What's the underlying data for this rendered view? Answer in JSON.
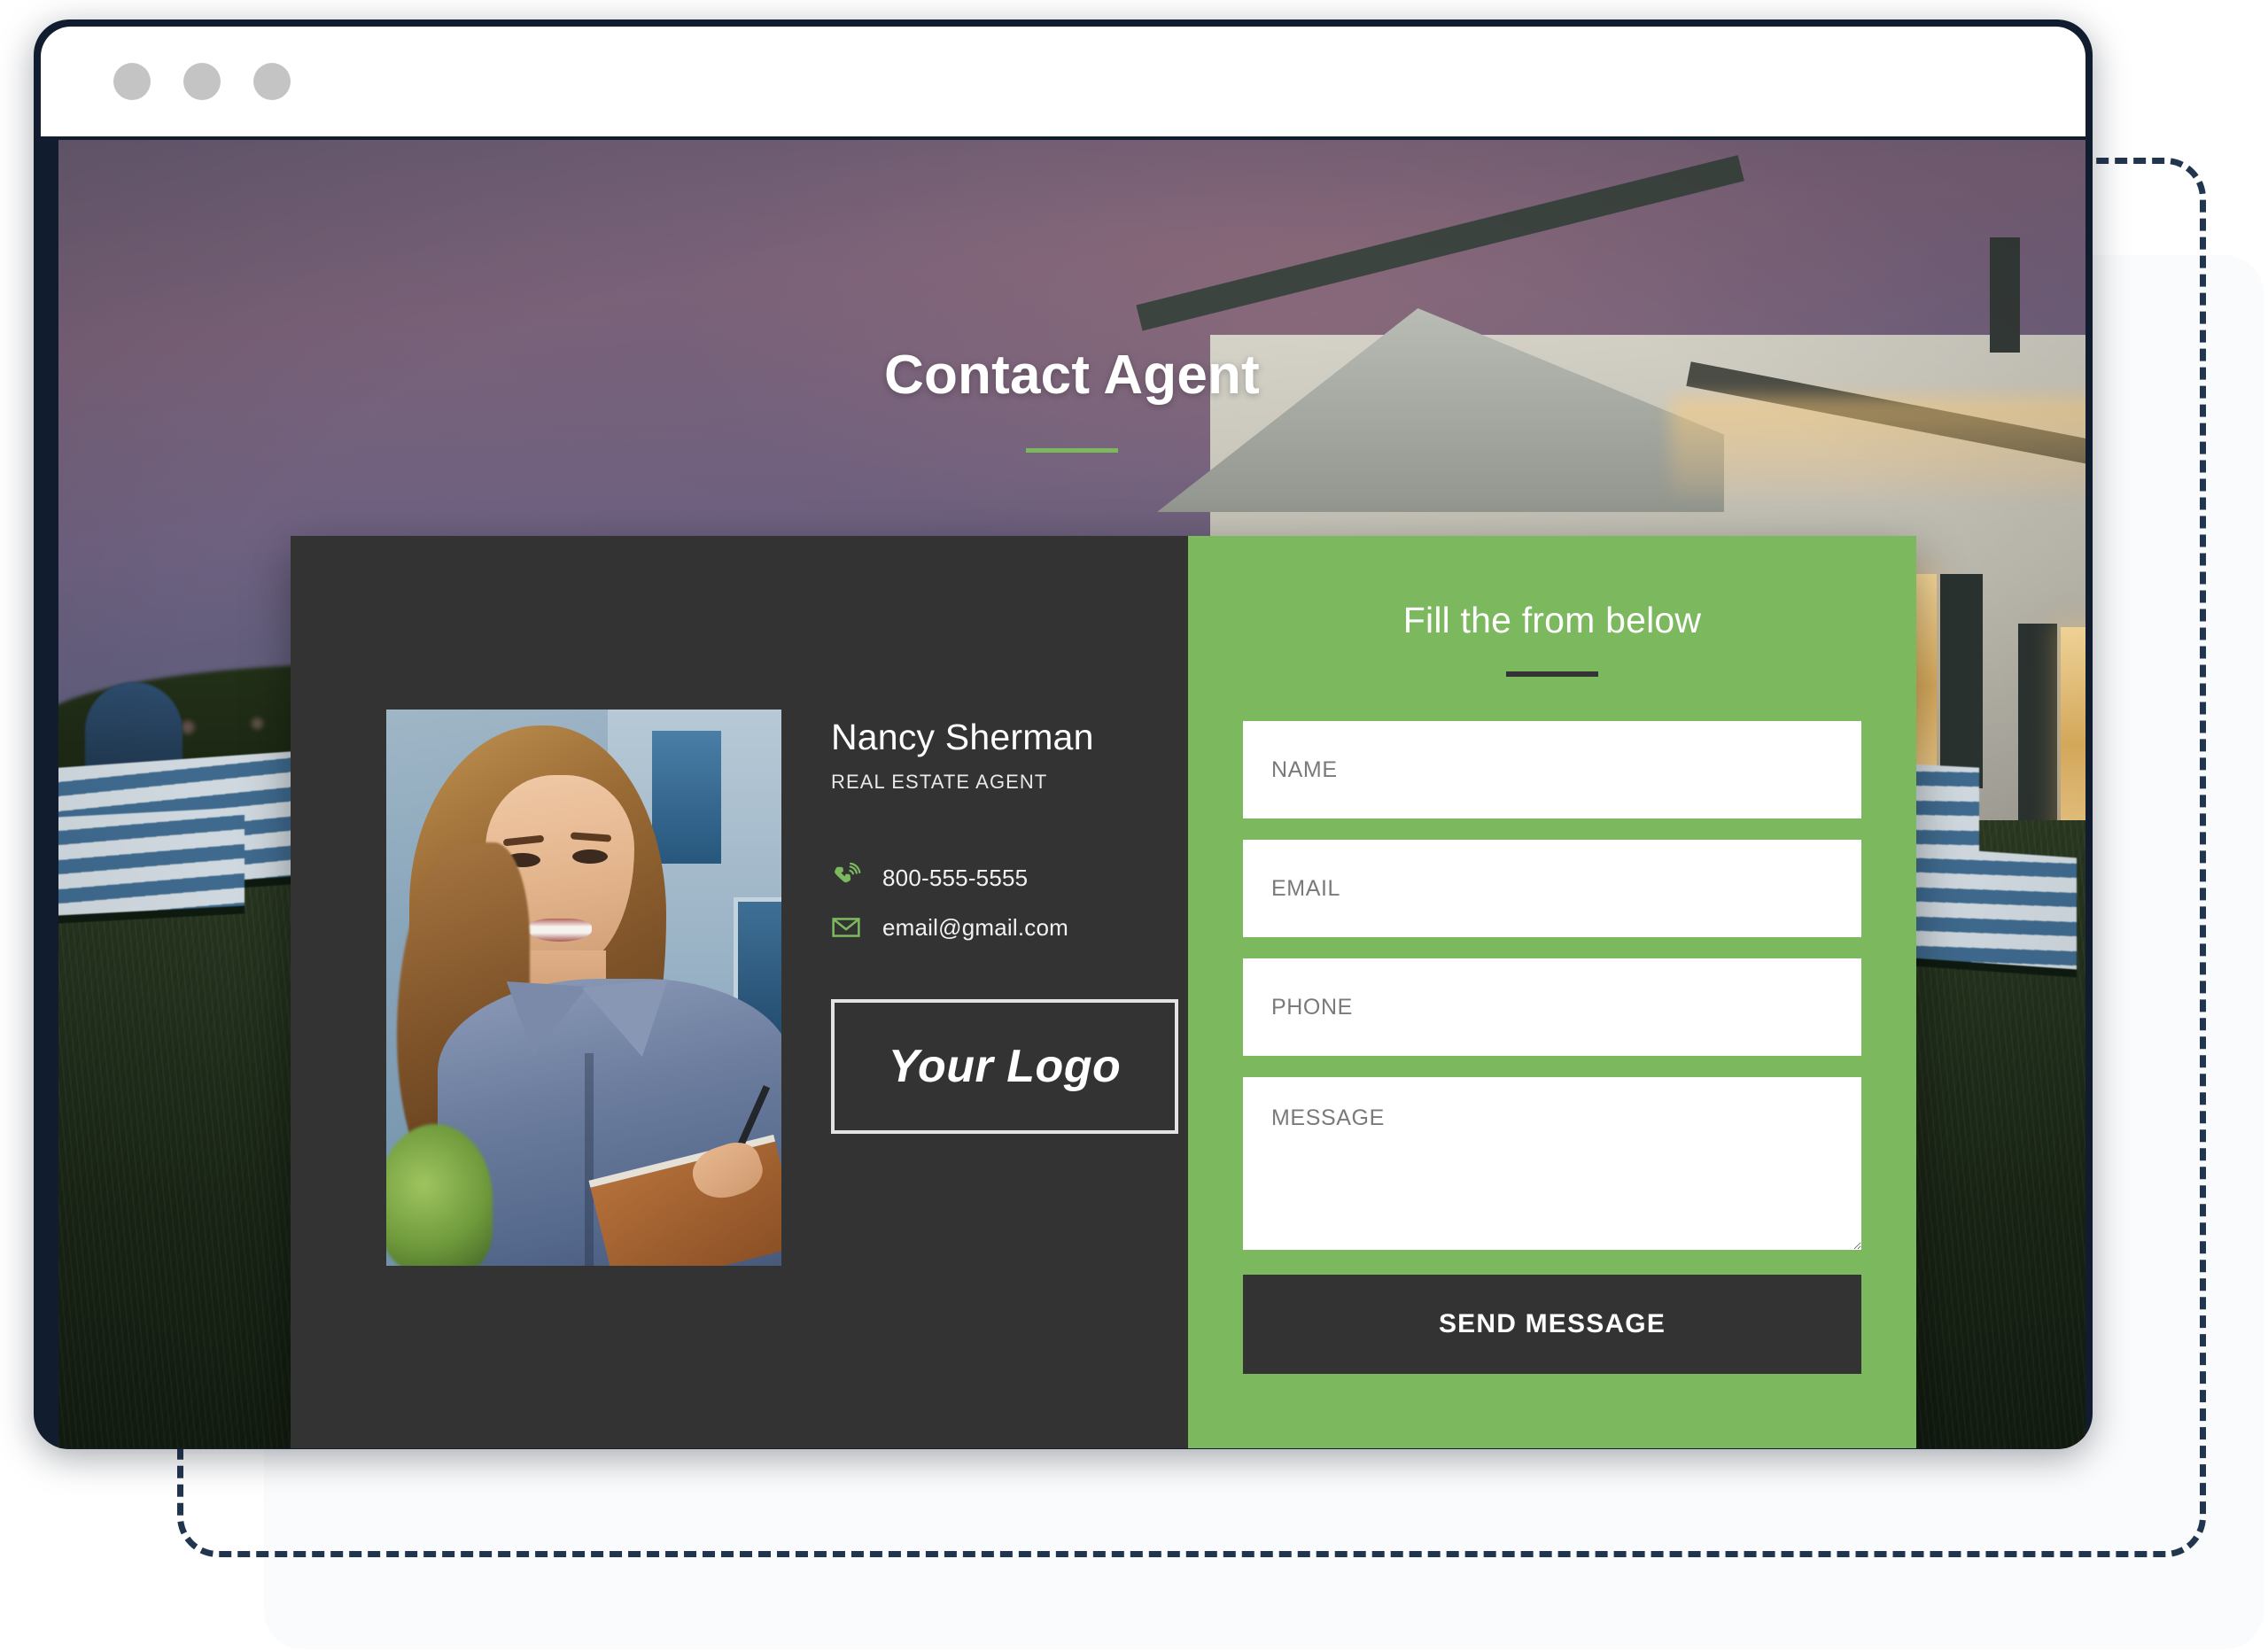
{
  "browser": {
    "window_dots": [
      "dot-red",
      "dot-yellow",
      "dot-green"
    ]
  },
  "page": {
    "title": "Contact Agent"
  },
  "agent": {
    "name": "Nancy Sherman",
    "role": "REAL ESTATE AGENT",
    "phone": "800-555-5555",
    "email": "email@gmail.com",
    "phone_icon": "phone-ringing-icon",
    "email_icon": "envelope-icon",
    "logo_text": "Your Logo",
    "photo_alt": "agent-portrait"
  },
  "form": {
    "heading": "Fill the from below",
    "fields": [
      {
        "name": "name",
        "placeholder": "NAME",
        "value": ""
      },
      {
        "name": "email",
        "placeholder": "EMAIL",
        "value": ""
      },
      {
        "name": "phone",
        "placeholder": "PHONE",
        "value": ""
      },
      {
        "name": "message",
        "placeholder": "MESSAGE",
        "value": ""
      }
    ],
    "submit_label": "SEND MESSAGE"
  },
  "colors": {
    "accent_green": "#7cb85e",
    "panel_dark": "#333333",
    "frame_navy": "#22354f",
    "title_text": "#ffffff"
  }
}
